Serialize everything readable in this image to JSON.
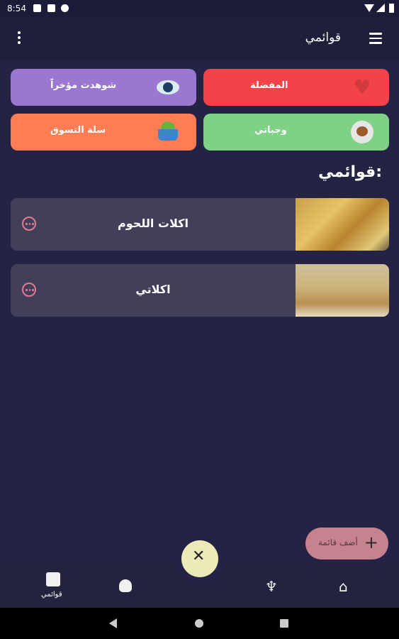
{
  "status_bar": {
    "time": "8:54"
  },
  "app_bar": {
    "title": "قوائمي"
  },
  "tiles": {
    "watched": {
      "label": "شوهدت مؤخراً",
      "color": "#9a78d2",
      "icon": "eye-icon"
    },
    "favorites": {
      "label": "المفضلة",
      "color": "#f24348",
      "icon": "heart-icon"
    },
    "cart": {
      "label": "سلة التسوق",
      "color": "#ff7d55",
      "icon": "basket-icon"
    },
    "meals": {
      "label": "وجباتي",
      "color": "#7fd186",
      "icon": "chicken-icon"
    }
  },
  "section": {
    "title": "قوائمي:"
  },
  "lists": [
    {
      "name": "اكلات اللحوم"
    },
    {
      "name": "اكلاتي"
    }
  ],
  "fab": {
    "label": "أضف قائمة",
    "icon": "plus-icon"
  },
  "bottom_nav": {
    "lists_label": "قوائمي"
  },
  "icons": {
    "heart": "♥",
    "plus": "+",
    "utensils": "✕",
    "home": "⌂",
    "whisk": "♆"
  }
}
